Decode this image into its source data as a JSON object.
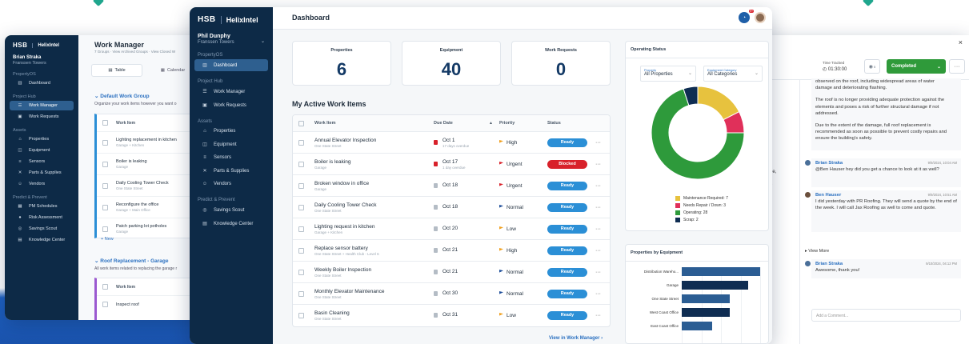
{
  "left_window": {
    "brand": {
      "hsb": "HSB",
      "helix": "HelixIntel"
    },
    "user": {
      "name": "Brian Straka",
      "org": "Franssen Towers"
    },
    "sections": [
      "PropertyOS",
      "Project Hub",
      "Assets",
      "Predict & Prevent"
    ],
    "nav_propertyos": [
      "Dashboard"
    ],
    "nav_project": [
      "Work Manager",
      "Work Requests"
    ],
    "nav_assets": [
      "Properties",
      "Equipment",
      "Sensors",
      "Parts & Supplies",
      "Vendors"
    ],
    "nav_predict": [
      "PM Schedules",
      "Risk Assessment",
      "Savings Scout",
      "Knowledge Center"
    ],
    "title": "Work Manager",
    "subtitle": "7 Groups · View Archived Groups · View Closed W",
    "tabs": [
      "Table",
      "Calendar"
    ],
    "group1": {
      "title": "Default Work Group",
      "desc": "Organize your work items however you want o",
      "header": "Work Item",
      "items": [
        {
          "name": "Lighting replacement in kitchen",
          "sub": "Garage + Kitchen"
        },
        {
          "name": "Boiler is leaking",
          "sub": "Garage"
        },
        {
          "name": "Daily Cooling Tower Check",
          "sub": "One State Street"
        },
        {
          "name": "Reconfigure the office",
          "sub": "Garage + Main Office"
        },
        {
          "name": "Patch parking lot potholes",
          "sub": "Garage"
        }
      ]
    },
    "new_label": "+ New",
    "group2": {
      "title": "Roof Replacement - Garage",
      "desc": "All work items related to replacing the garage r",
      "header": "Work Item",
      "items": [
        {
          "name": "Inspect roof"
        }
      ]
    }
  },
  "main_window": {
    "brand": {
      "hsb": "HSB",
      "helix": "HelixIntel"
    },
    "user": {
      "name": "Phil Dunphy",
      "org": "Franssen Towers"
    },
    "sections": [
      "PropertyOS",
      "Project Hub",
      "Assets",
      "Predict & Prevent"
    ],
    "nav_propertyos": [
      "Dashboard"
    ],
    "nav_project": [
      "Work Manager",
      "Work Requests"
    ],
    "nav_assets": [
      "Properties",
      "Equipment",
      "Sensors",
      "Parts & Supplies",
      "Vendors"
    ],
    "nav_predict": [
      "Savings Scout",
      "Knowledge Center"
    ],
    "page_title": "Dashboard",
    "notif_count": "9+",
    "stats": [
      {
        "label": "Properties",
        "value": "6"
      },
      {
        "label": "Equipment",
        "value": "40"
      },
      {
        "label": "Work Requests",
        "value": "0"
      }
    ],
    "active_title": "My Active Work Items",
    "columns": [
      "Work Item",
      "Due Date",
      "Priority",
      "Status"
    ],
    "rows": [
      {
        "name": "Annual Elevator Inspection",
        "sub": "One State Street",
        "due": "Oct 1",
        "due_sub": "17 days overdue",
        "priority": "High",
        "status": "Ready",
        "overdue": true
      },
      {
        "name": "Boiler is leaking",
        "sub": "Garage",
        "due": "Oct 17",
        "due_sub": "1 day overdue",
        "priority": "Urgent",
        "status": "Blocked",
        "overdue": true
      },
      {
        "name": "Broken window in office",
        "sub": "Garage",
        "due": "Oct 18",
        "due_sub": "",
        "priority": "Urgent",
        "status": "Ready",
        "overdue": false
      },
      {
        "name": "Daily Cooling Tower Check",
        "sub": "One State Street",
        "due": "Oct 18",
        "due_sub": "",
        "priority": "Normal",
        "status": "Ready",
        "overdue": false
      },
      {
        "name": "Lighting request in kitchen",
        "sub": "Garage + Kitchen",
        "due": "Oct 20",
        "due_sub": "",
        "priority": "Low",
        "status": "Ready",
        "overdue": false
      },
      {
        "name": "Replace sensor battery",
        "sub": "One State Street + Health Club - Level 6",
        "due": "Oct 21",
        "due_sub": "",
        "priority": "High",
        "status": "Ready",
        "overdue": false
      },
      {
        "name": "Weekly Boiler Inspection",
        "sub": "One State Street",
        "due": "Oct 21",
        "due_sub": "",
        "priority": "Normal",
        "status": "Ready",
        "overdue": false
      },
      {
        "name": "Monthly Elevator Maintenance",
        "sub": "One State Street",
        "due": "Oct 30",
        "due_sub": "",
        "priority": "Normal",
        "status": "Ready",
        "overdue": false
      },
      {
        "name": "Basin Cleaning",
        "sub": "One State Street",
        "due": "Oct 31",
        "due_sub": "",
        "priority": "Low",
        "status": "Ready",
        "overdue": false
      }
    ],
    "view_link": "View in Work Manager  ›",
    "operating": {
      "title": "Operating Status",
      "prop_label": "Property",
      "prop_value": "All Properties",
      "cat_label": "Equipment Category",
      "cat_value": "All Categories"
    },
    "bars_title": "Properties by Equipment"
  },
  "right_window": {
    "time_label": "Time Tracked",
    "time_value": "01:30:00",
    "badge": "5",
    "completed": "Completed",
    "comment_top": [
      "observed on the roof, including widespread areas of water",
      "damage and deteriorating flashing."
    ],
    "comment_p2": "The roof is no longer providing adequate protection against the elements and poses a risk of further structural damage if not addressed.",
    "comment_p3": "Due to the extent of the damage, full roof replacement is recommended as soon as possible to prevent costly repairs and ensure the building's safety.",
    "comments": [
      {
        "author": "Brian Straka",
        "date": "9/9/2024, 10:04 AM",
        "text": "@Ben Hauser hey did you get a chance to look at it as well?"
      },
      {
        "author": "Ben Hauser",
        "date": "9/9/2024, 10:51 AM",
        "text": "I did yesterday with PR Roofing. They will send a quote by the end of the week. I will call Jax Roofing as well to come and quote."
      }
    ],
    "view_more": "▸ View More",
    "last_comment": {
      "author": "Brian Straka",
      "date": "9/10/2024, 04:12 PM",
      "text": "Awesome, thank you!"
    },
    "add_placeholder": "Add a Comment...",
    "edge_text": [
      "ge,",
      "s",
      "e"
    ]
  },
  "colors": {
    "navy": "#0d2a47",
    "ready": "#2b8fd6",
    "blocked": "#d8212a",
    "completed": "#2f9a3a",
    "maintenance": "#e7c23e",
    "repair": "#e0305a",
    "operating": "#2e9a3b",
    "scrap": "#0f2d52"
  },
  "chart_data": [
    {
      "type": "pie",
      "title": "Operating Status",
      "labels": [
        "Maintenance Required",
        "Needs Repair / Down",
        "Operating",
        "Scrap"
      ],
      "values": [
        7,
        3,
        28,
        2
      ],
      "legend": [
        "Maintenance Required: 7",
        "Needs Repair / Down: 3",
        "Operating: 28",
        "Scrap: 2"
      ],
      "colors": [
        "#e7c23e",
        "#e0305a",
        "#2e9a3b",
        "#0f2d52"
      ]
    },
    {
      "type": "bar",
      "title": "Properties by Equipment",
      "categories": [
        "Distribution Wareho...",
        "Garage",
        "One State Street",
        "West Coast Office",
        "East Coast Office"
      ],
      "values": [
        13,
        11,
        8,
        8,
        5
      ],
      "colors": [
        "#2b5d93",
        "#0f2d52",
        "#2b5d93",
        "#0f2d52",
        "#2b5d93"
      ]
    }
  ]
}
